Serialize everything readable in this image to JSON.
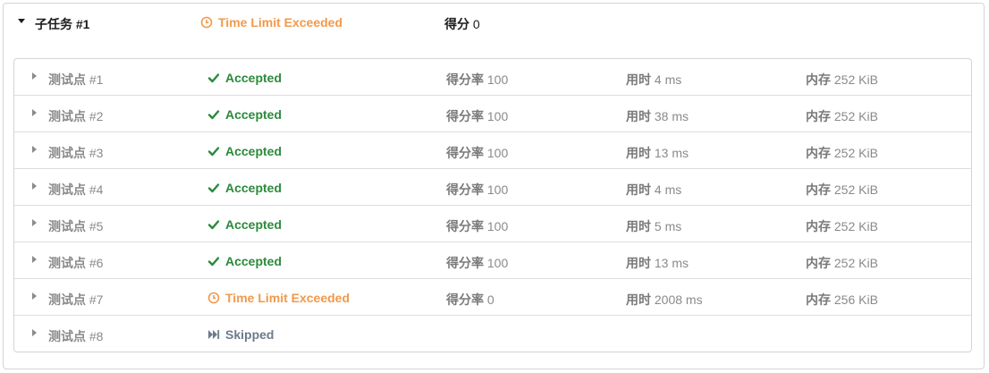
{
  "subtask": {
    "title": "子任务 #1",
    "status": "Time Limit Exceeded",
    "score_label": "得分",
    "score_value": "0"
  },
  "labels": {
    "rate": "得分率",
    "time": "用时",
    "memory": "内存"
  },
  "colors": {
    "accepted": "#2a8a3a",
    "tle": "#f2994a",
    "skipped": "#6d7b8a"
  },
  "cases": [
    {
      "name": "测试点",
      "num": "#1",
      "result": "Accepted",
      "icon": "check-icon",
      "rate": "100",
      "time": "4 ms",
      "memory": "252 KiB"
    },
    {
      "name": "测试点",
      "num": "#2",
      "result": "Accepted",
      "icon": "check-icon",
      "rate": "100",
      "time": "38 ms",
      "memory": "252 KiB"
    },
    {
      "name": "测试点",
      "num": "#3",
      "result": "Accepted",
      "icon": "check-icon",
      "rate": "100",
      "time": "13 ms",
      "memory": "252 KiB"
    },
    {
      "name": "测试点",
      "num": "#4",
      "result": "Accepted",
      "icon": "check-icon",
      "rate": "100",
      "time": "4 ms",
      "memory": "252 KiB"
    },
    {
      "name": "测试点",
      "num": "#5",
      "result": "Accepted",
      "icon": "check-icon",
      "rate": "100",
      "time": "5 ms",
      "memory": "252 KiB"
    },
    {
      "name": "测试点",
      "num": "#6",
      "result": "Accepted",
      "icon": "check-icon",
      "rate": "100",
      "time": "13 ms",
      "memory": "252 KiB"
    },
    {
      "name": "测试点",
      "num": "#7",
      "result": "Time Limit Exceeded",
      "icon": "clock-icon",
      "rate": "0",
      "time": "2008 ms",
      "memory": "256 KiB"
    },
    {
      "name": "测试点",
      "num": "#8",
      "result": "Skipped",
      "icon": "fast-forward-icon"
    }
  ]
}
